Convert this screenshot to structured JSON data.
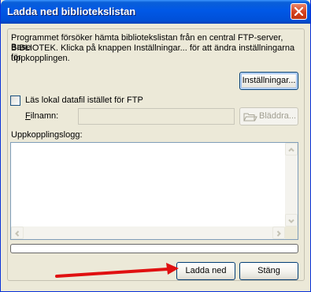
{
  "window": {
    "title": "Ladda ned bibliotekslistan"
  },
  "info": {
    "line1": "Programmet försöker hämta bibliotekslistan från en central FTP-server, Base",
    "line2": "BIBLIOTEK. Klicka på knappen Inställningar... för att ändra inställningarna för",
    "line3": "uppkopplingen."
  },
  "buttons": {
    "settings": "Inställningar...",
    "browse": "Bläddra...",
    "download": "Ladda ned",
    "close": "Stäng"
  },
  "local_file": {
    "checkbox_label": "Läs lokal datafil istället för FTP",
    "checked": false
  },
  "filename": {
    "label": "Filnamn:",
    "value": ""
  },
  "log": {
    "label": "Uppkopplingslogg:",
    "content": ""
  },
  "progress": {
    "percent": 0
  },
  "colors": {
    "annotation_arrow": "#e01010",
    "titlebar": "#0058e6"
  },
  "icons": {
    "close": "close-icon",
    "folder": "folder-open-icon"
  }
}
